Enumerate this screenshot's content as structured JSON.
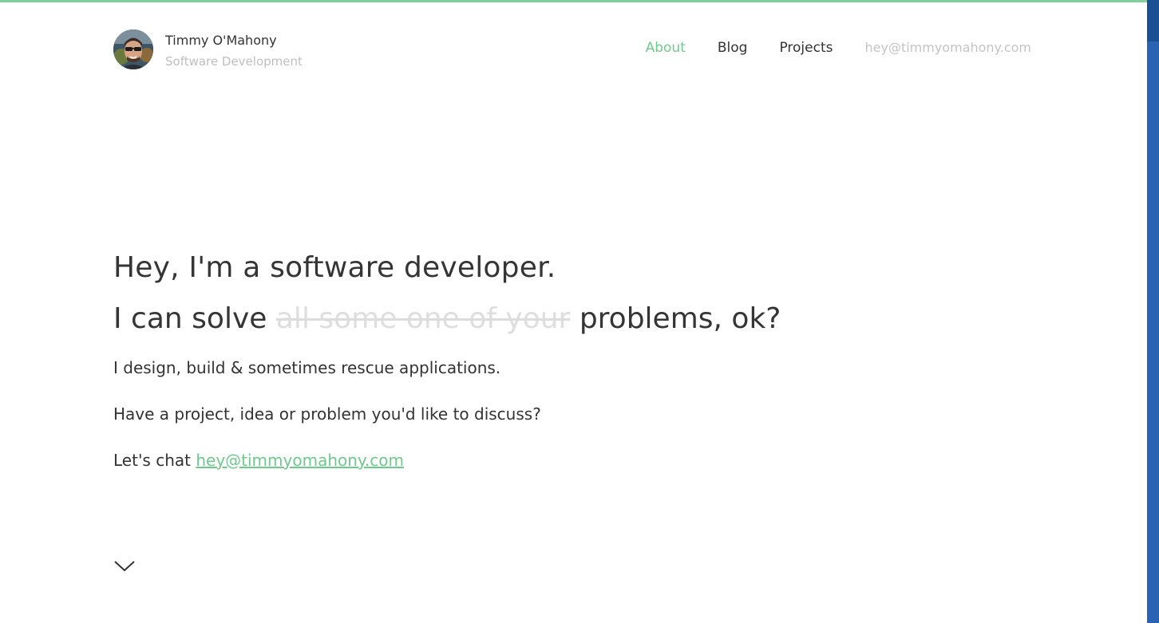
{
  "colors": {
    "accent": "#6ccb8b",
    "text": "#333333",
    "muted": "#bfbfbf",
    "top_border": "#7fcf98",
    "right_strip": "#2a63b3"
  },
  "brand": {
    "name": "Timmy O'Mahony",
    "tagline": "Software Development",
    "avatar_icon": "avatar-photo"
  },
  "nav": {
    "items": [
      {
        "label": "About",
        "active": true
      },
      {
        "label": "Blog",
        "active": false
      },
      {
        "label": "Projects",
        "active": false
      }
    ],
    "email": "hey@timmyomahony.com"
  },
  "hero": {
    "headline": "Hey, I'm a software developer.",
    "subhead_prefix": "I can solve",
    "subhead_strike": "all some one of your",
    "subhead_suffix": "problems, ok?",
    "paragraph_1": "I design, build & sometimes rescue applications.",
    "paragraph_2": "Have a project, idea or problem you'd like to discuss?",
    "paragraph_3_prefix": "Let's chat",
    "contact_email": "hey@timmyomahony.com"
  },
  "scroll_icon": "chevron-down-icon"
}
